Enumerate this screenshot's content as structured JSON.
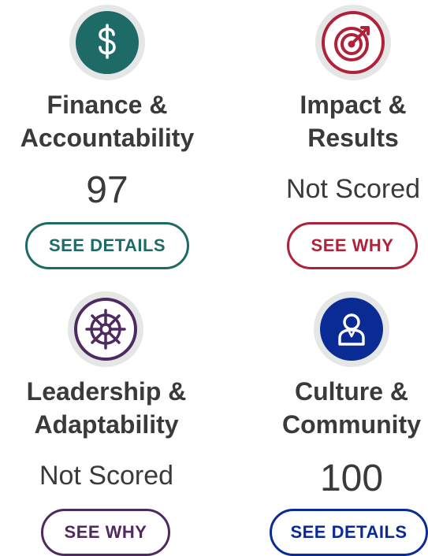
{
  "colors": {
    "finance": "#1e6a66",
    "impact": "#b0213a",
    "leadership": "#4e2a60",
    "culture": "#0a2b94",
    "text": "#3a3a3a"
  },
  "cards": [
    {
      "icon": "dollar-icon",
      "title_line1": "Finance &",
      "title_line2": "Accountability",
      "score": "97",
      "button_label": "SEE DETAILS"
    },
    {
      "icon": "target-icon",
      "title_line1": "Impact &",
      "title_line2": "Results",
      "score": "Not Scored",
      "button_label": "SEE WHY"
    },
    {
      "icon": "ship-wheel-icon",
      "title_line1": "Leadership &",
      "title_line2": "Adaptability",
      "score": "Not Scored",
      "button_label": "SEE WHY"
    },
    {
      "icon": "person-icon",
      "title_line1": "Culture &",
      "title_line2": "Community",
      "score": "100",
      "button_label": "SEE DETAILS"
    }
  ]
}
